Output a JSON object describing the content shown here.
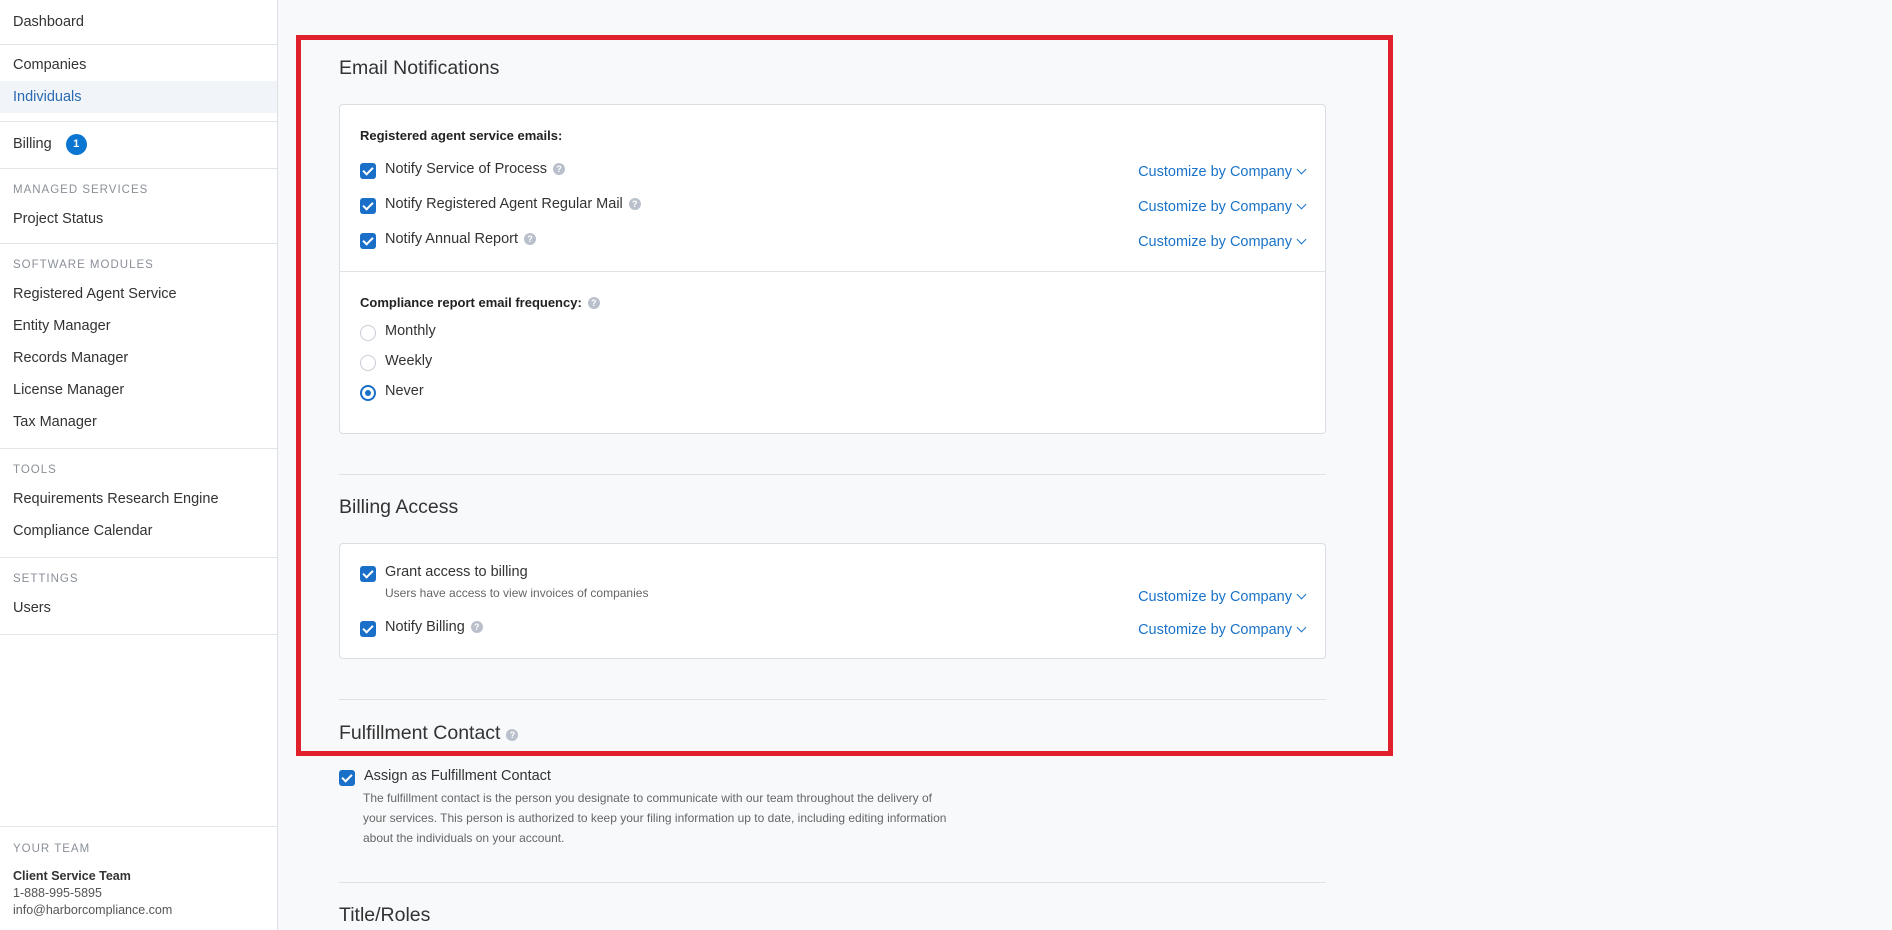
{
  "sidebar": {
    "dashboard": "Dashboard",
    "companies": "Companies",
    "individuals": "Individuals",
    "billing": "Billing",
    "billing_badge": "1",
    "managed_services": "MANAGED SERVICES",
    "project_status": "Project Status",
    "software_modules": "SOFTWARE MODULES",
    "modules": [
      "Registered Agent Service",
      "Entity Manager",
      "Records Manager",
      "License Manager",
      "Tax Manager"
    ],
    "tools": "TOOLS",
    "tool_items": [
      "Requirements Research Engine",
      "Compliance Calendar"
    ],
    "settings": "SETTINGS",
    "users": "Users",
    "team": {
      "label": "YOUR TEAM",
      "name": "Client Service Team",
      "phone": "1-888-995-5895",
      "email": "info@harborcompliance.com"
    }
  },
  "email": {
    "title": "Email Notifications",
    "ra_heading": "Registered agent service emails:",
    "items": [
      {
        "label": "Notify Service of Process",
        "checked": true,
        "customize": "Customize by Company"
      },
      {
        "label": "Notify Registered Agent Regular Mail",
        "checked": true,
        "customize": "Customize by Company"
      },
      {
        "label": "Notify Annual Report",
        "checked": true,
        "customize": "Customize by Company"
      }
    ],
    "freq_heading": "Compliance report email frequency:",
    "freq_options": [
      "Monthly",
      "Weekly",
      "Never"
    ],
    "freq_selected": "Never"
  },
  "billing_access": {
    "title": "Billing Access",
    "grant_label": "Grant access to billing",
    "grant_sub": "Users have access to view invoices of companies",
    "grant_customize": "Customize by Company",
    "notify_label": "Notify Billing",
    "notify_customize": "Customize by Company"
  },
  "fulfillment": {
    "title": "Fulfillment Contact",
    "assign_label": "Assign as Fulfillment Contact",
    "desc_lines": [
      "The fulfillment contact is the person you designate to communicate with our team throughout the delivery of",
      "your services. This person is authorized to keep your filing information up to date, including editing information",
      "about the individuals on your account."
    ]
  },
  "title_roles": {
    "title": "Title/Roles"
  },
  "colors": {
    "accent": "#1a6fc9",
    "highlight": "#e0202a"
  }
}
